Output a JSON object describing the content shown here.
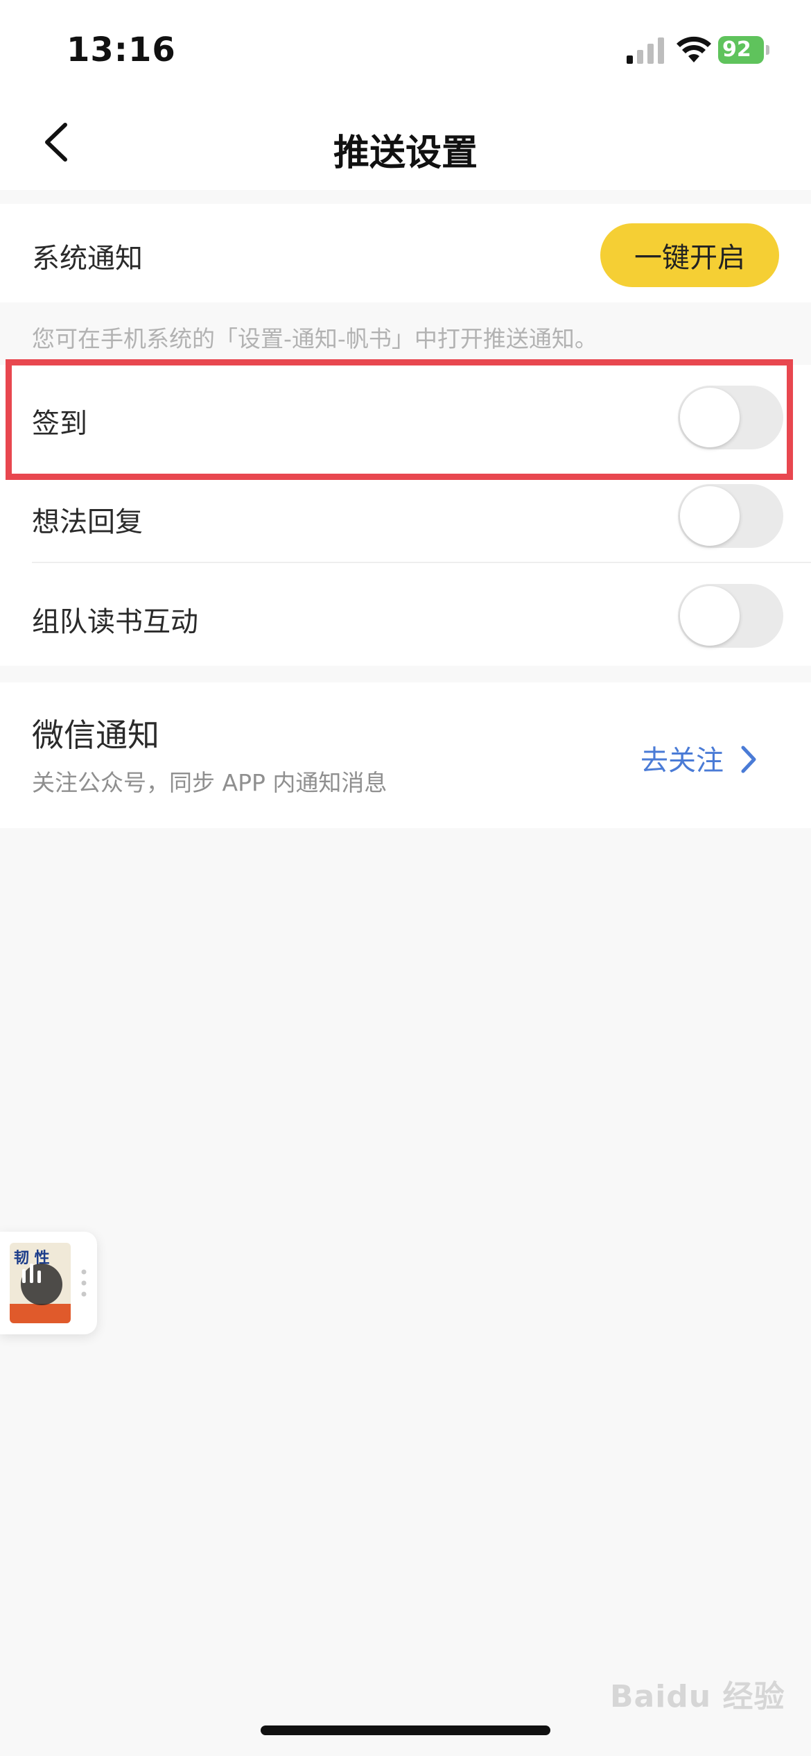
{
  "status_bar": {
    "time": "13:16",
    "battery_level": "92"
  },
  "nav": {
    "title": "推送设置"
  },
  "system_notice": {
    "label": "系统通知",
    "button_label": "一键开启"
  },
  "hint": {
    "text": "您可在手机系统的「设置-通知-帆书」中打开推送通知。"
  },
  "toggles": [
    {
      "label": "签到",
      "on": false
    },
    {
      "label": "想法回复",
      "on": false
    },
    {
      "label": "组队读书互动",
      "on": false
    }
  ],
  "wechat": {
    "title": "微信通知",
    "subtitle": "关注公众号，同步 APP 内通知消息",
    "link_label": "去关注"
  },
  "mini_player": {
    "cover_title": "韧 性"
  },
  "watermark": {
    "text": "Baidu 经验"
  },
  "colors": {
    "accent_yellow": "#f5cf34",
    "link_blue": "#4a7bd6",
    "highlight_red": "#e8474f",
    "battery_green": "#5fc35c"
  },
  "icons": {
    "back": "chevron-left-icon",
    "link": "chevron-right-icon",
    "signal": "cellular-signal-icon",
    "wifi": "wifi-icon",
    "battery": "battery-icon",
    "player": "audio-bars-icon"
  }
}
